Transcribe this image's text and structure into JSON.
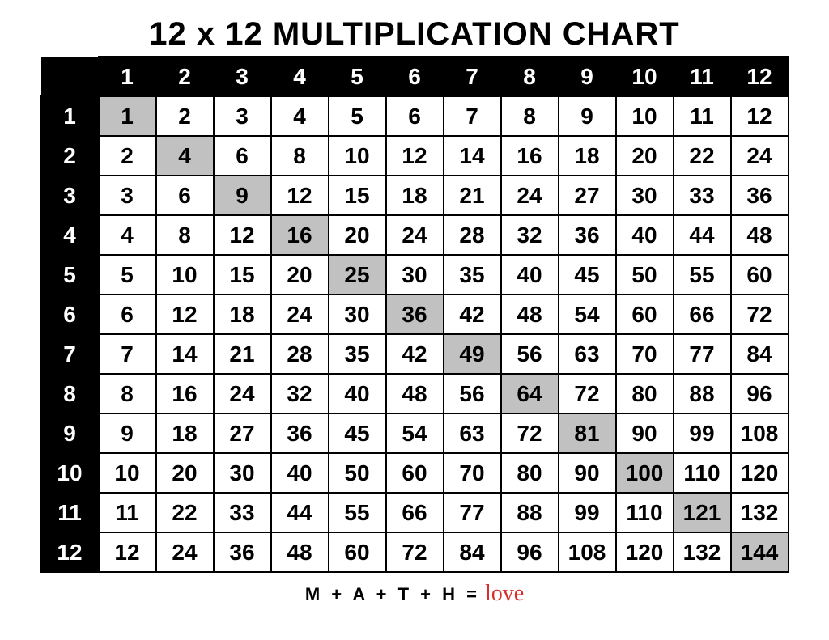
{
  "title": "12 x 12 MULTIPLICATION CHART",
  "col_headers": [
    "1",
    "2",
    "3",
    "4",
    "5",
    "6",
    "7",
    "8",
    "9",
    "10",
    "11",
    "12"
  ],
  "row_headers": [
    "1",
    "2",
    "3",
    "4",
    "5",
    "6",
    "7",
    "8",
    "9",
    "10",
    "11",
    "12"
  ],
  "chart_data": {
    "type": "table",
    "title": "12 x 12 Multiplication Chart",
    "rows": [
      "1",
      "2",
      "3",
      "4",
      "5",
      "6",
      "7",
      "8",
      "9",
      "10",
      "11",
      "12"
    ],
    "cols": [
      "1",
      "2",
      "3",
      "4",
      "5",
      "6",
      "7",
      "8",
      "9",
      "10",
      "11",
      "12"
    ],
    "values": [
      [
        1,
        2,
        3,
        4,
        5,
        6,
        7,
        8,
        9,
        10,
        11,
        12
      ],
      [
        2,
        4,
        6,
        8,
        10,
        12,
        14,
        16,
        18,
        20,
        22,
        24
      ],
      [
        3,
        6,
        9,
        12,
        15,
        18,
        21,
        24,
        27,
        30,
        33,
        36
      ],
      [
        4,
        8,
        12,
        16,
        20,
        24,
        28,
        32,
        36,
        40,
        44,
        48
      ],
      [
        5,
        10,
        15,
        20,
        25,
        30,
        35,
        40,
        45,
        50,
        55,
        60
      ],
      [
        6,
        12,
        18,
        24,
        30,
        36,
        42,
        48,
        54,
        60,
        66,
        72
      ],
      [
        7,
        14,
        21,
        28,
        35,
        42,
        49,
        56,
        63,
        70,
        77,
        84
      ],
      [
        8,
        16,
        24,
        32,
        40,
        48,
        56,
        64,
        72,
        80,
        88,
        96
      ],
      [
        9,
        18,
        27,
        36,
        45,
        54,
        63,
        72,
        81,
        90,
        99,
        108
      ],
      [
        10,
        20,
        30,
        40,
        50,
        60,
        70,
        80,
        90,
        100,
        110,
        120
      ],
      [
        11,
        22,
        33,
        44,
        55,
        66,
        77,
        88,
        99,
        110,
        121,
        132
      ],
      [
        12,
        24,
        36,
        48,
        60,
        72,
        84,
        96,
        108,
        120,
        132,
        144
      ]
    ],
    "diagonal_highlight": true
  },
  "footer": {
    "math_text": "M + A + T + H =",
    "love_text": "love"
  }
}
